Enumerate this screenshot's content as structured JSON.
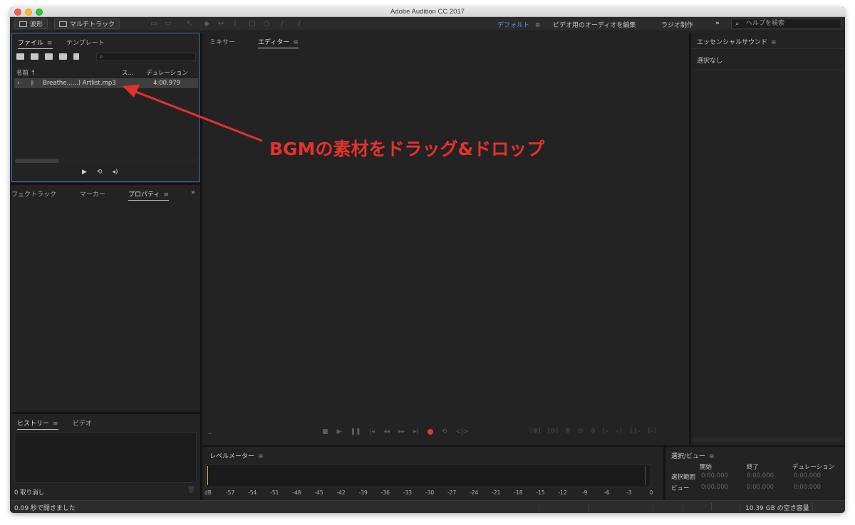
{
  "window": {
    "title": "Adobe Audition CC 2017"
  },
  "toolbar": {
    "waveform_label": "波形",
    "multitrack_label": "マルチトラック",
    "workspaces": [
      "デフォルト",
      "ビデオ用のオーディオを編集",
      "ラジオ制作"
    ],
    "active_workspace_menu": "≡",
    "overflow": "»",
    "help_search_placeholder": "ヘルプを検索"
  },
  "files_panel": {
    "tabs": [
      "ファイル",
      "テンプレート"
    ],
    "search_glyph": "⌕",
    "columns": {
      "name": "名前 ↑",
      "status": "ス...",
      "duration": "デュレーション"
    },
    "files": [
      {
        "name": "Breathe......) Artlist.mp3",
        "duration": "4:00.979"
      }
    ]
  },
  "props_panel": {
    "tabs": [
      "フェクトラック",
      "マーカー",
      "プロパティ"
    ],
    "overflow": "»"
  },
  "history_panel": {
    "tabs": [
      "ヒストリー",
      "ビデオ"
    ],
    "undo_count": "0 取り消し"
  },
  "editor_panel": {
    "tabs": [
      "ミキサー",
      "エディター"
    ]
  },
  "level_meter": {
    "title": "レベルメーター",
    "scale": [
      "dB",
      "-57",
      "-54",
      "-51",
      "-48",
      "-45",
      "-42",
      "-39",
      "-36",
      "-33",
      "-30",
      "-27",
      "-24",
      "-21",
      "-18",
      "-15",
      "-12",
      "-9",
      "-6",
      "-3",
      "0"
    ]
  },
  "selection_panel": {
    "title": "選択/ビュー",
    "headers": [
      "開始",
      "終了",
      "デュレーション"
    ],
    "rows": [
      {
        "label": "選択範囲",
        "values": [
          "0:00.000",
          "0:00.000",
          "0:00.000"
        ]
      },
      {
        "label": "ビュー",
        "values": [
          "0:00.000",
          "0:00.000",
          "0:00.000"
        ]
      }
    ]
  },
  "essential_panel": {
    "title": "エッセンシャルサウンド",
    "empty_text": "選択なし"
  },
  "status_bar": {
    "left_text": "0.09 秒で開きました",
    "right_text": "10.39 GB の空き容量"
  },
  "annotation": {
    "text": "BGMの素材をドラッグ&ドロップ",
    "color": "#e6322b"
  },
  "colors": {
    "accent": "#4f9ae8",
    "record": "#e23b2e",
    "panel_bg": "#232323"
  }
}
